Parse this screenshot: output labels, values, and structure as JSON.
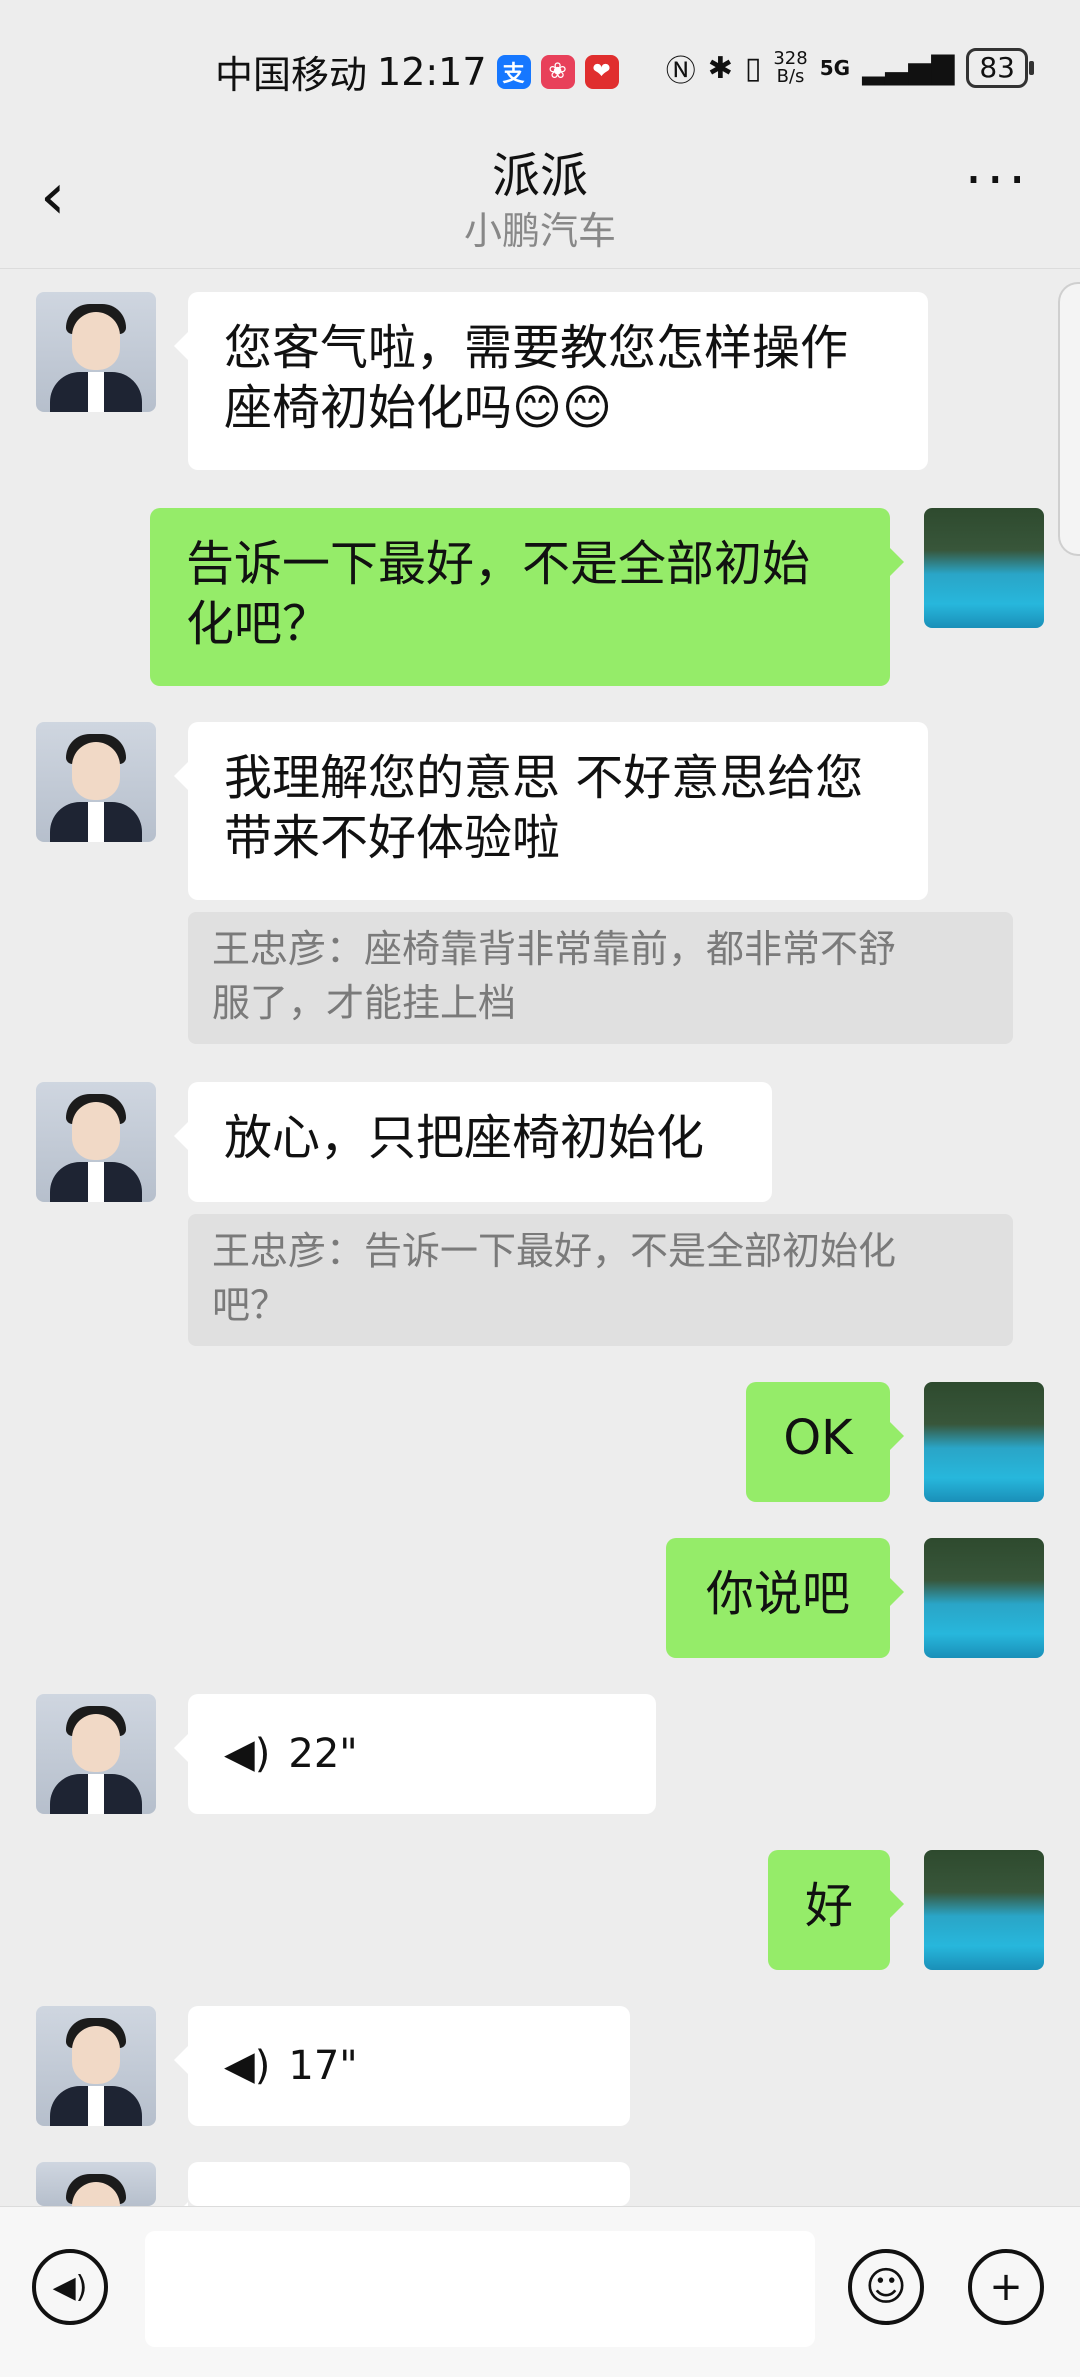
{
  "status_bar": {
    "carrier": "中国移动",
    "time": "12:17",
    "app_icons": [
      "支",
      "❀",
      "❤"
    ],
    "net_speed": "328\nB/s",
    "network": "5G",
    "battery": "83"
  },
  "nav": {
    "back_icon": "chevron-left-icon",
    "title": "派派",
    "subtitle": "小鹏汽车",
    "more_label": "···"
  },
  "messages": [
    {
      "side": "left",
      "text": "您客气啦，需要教您怎样操作\n座椅初始化吗😊😊"
    },
    {
      "side": "right",
      "text": "告诉一下最好，不是全部初始\n化吧？"
    },
    {
      "side": "left",
      "text": "我理解您的意思 不好意思给您\n带来不好体验啦",
      "quote": "王忠彦：座椅靠背非常靠前，都非常不舒\n服了，才能挂上档"
    },
    {
      "side": "left",
      "text": "放心，只把座椅初始化",
      "quote": "王忠彦：告诉一下最好，不是全部初始化\n吧？"
    },
    {
      "side": "right",
      "text": "OK"
    },
    {
      "side": "right",
      "text": "你说吧"
    },
    {
      "side": "left",
      "voice": "22\""
    },
    {
      "side": "right",
      "text": "好"
    },
    {
      "side": "left",
      "voice": "17\""
    }
  ],
  "input_bar": {
    "voice_icon": "voice-input-icon",
    "emoji_icon": "emoji-icon",
    "plus_icon": "plus-icon"
  }
}
